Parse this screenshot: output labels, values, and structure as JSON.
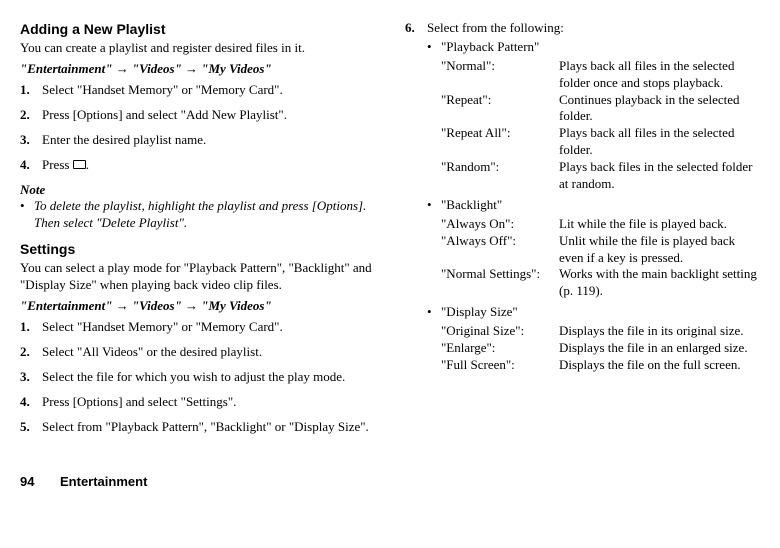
{
  "left": {
    "heading1": "Adding a New Playlist",
    "intro1": "You can create a playlist and register desired files in it.",
    "breadcrumb": "\"Entertainment\" → \"Videos\" → \"My Videos\"",
    "steps1": [
      {
        "n": "1.",
        "t": "Select \"Handset Memory\" or \"Memory Card\"."
      },
      {
        "n": "2.",
        "t": "Press [Options] and select \"Add New Playlist\"."
      },
      {
        "n": "3.",
        "t": "Enter the desired playlist name."
      },
      {
        "n": "4.",
        "t": "Press "
      }
    ],
    "note_label": "Note",
    "note_text": "To delete the playlist, highlight the playlist and press [Options]. Then select \"Delete Playlist\".",
    "heading2": "Settings",
    "intro2": "You can select a play mode for \"Playback Pattern\", \"Backlight\" and \"Display Size\" when playing back video clip files.",
    "steps2": [
      {
        "n": "1.",
        "t": "Select \"Handset Memory\" or \"Memory Card\"."
      },
      {
        "n": "2.",
        "t": "Select \"All Videos\" or the desired playlist."
      },
      {
        "n": "3.",
        "t": "Select the file for which you wish to adjust the play mode."
      },
      {
        "n": "4.",
        "t": "Press [Options] and select \"Settings\"."
      },
      {
        "n": "5.",
        "t": "Select from \"Playback Pattern\", \"Backlight\" or \"Display Size\"."
      }
    ]
  },
  "right": {
    "step6_n": "6.",
    "step6_t": "Select from the following:",
    "groups": [
      {
        "title": "\"Playback Pattern\"",
        "items": [
          {
            "label": "\"Normal\":",
            "desc": "Plays back all files in the selected folder once and stops playback."
          },
          {
            "label": "\"Repeat\":",
            "desc": "Continues playback in the selected folder."
          },
          {
            "label": "\"Repeat All\":",
            "desc": "Plays back all files in the selected folder."
          },
          {
            "label": "\"Random\":",
            "desc": "Plays back files in the selected folder at random."
          }
        ]
      },
      {
        "title": "\"Backlight\"",
        "items": [
          {
            "label": "\"Always On\":",
            "desc": "Lit while the file is played back."
          },
          {
            "label": "\"Always Off\":",
            "desc": "Unlit while the file is played back even if a key is pressed."
          },
          {
            "label": "\"Normal Settings\":",
            "desc": "Works with the main backlight setting (p. 119)."
          }
        ]
      },
      {
        "title": "\"Display Size\"",
        "items": [
          {
            "label": "\"Original Size\":",
            "desc": "Displays the file in its original size."
          },
          {
            "label": "\"Enlarge\":",
            "desc": "Displays the file in an enlarged size."
          },
          {
            "label": "\"Full Screen\":",
            "desc": "Displays the file on the full screen."
          }
        ]
      }
    ]
  },
  "footer": {
    "page": "94",
    "section": "Entertainment"
  }
}
